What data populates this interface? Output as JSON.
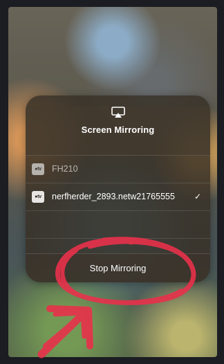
{
  "dialog": {
    "title": "Screen Mirroring",
    "icon": "airplay-icon"
  },
  "devices": [
    {
      "badge": "●tv",
      "name": "FH210",
      "selected": false
    },
    {
      "badge": "●tv",
      "name": "nerfherder_2893.netw21765555",
      "selected": true,
      "check": "✓"
    }
  ],
  "stop_button": {
    "label": "Stop Mirroring"
  },
  "colors": {
    "annotation_red": "#e8314b",
    "card_bg": "#372f26"
  }
}
